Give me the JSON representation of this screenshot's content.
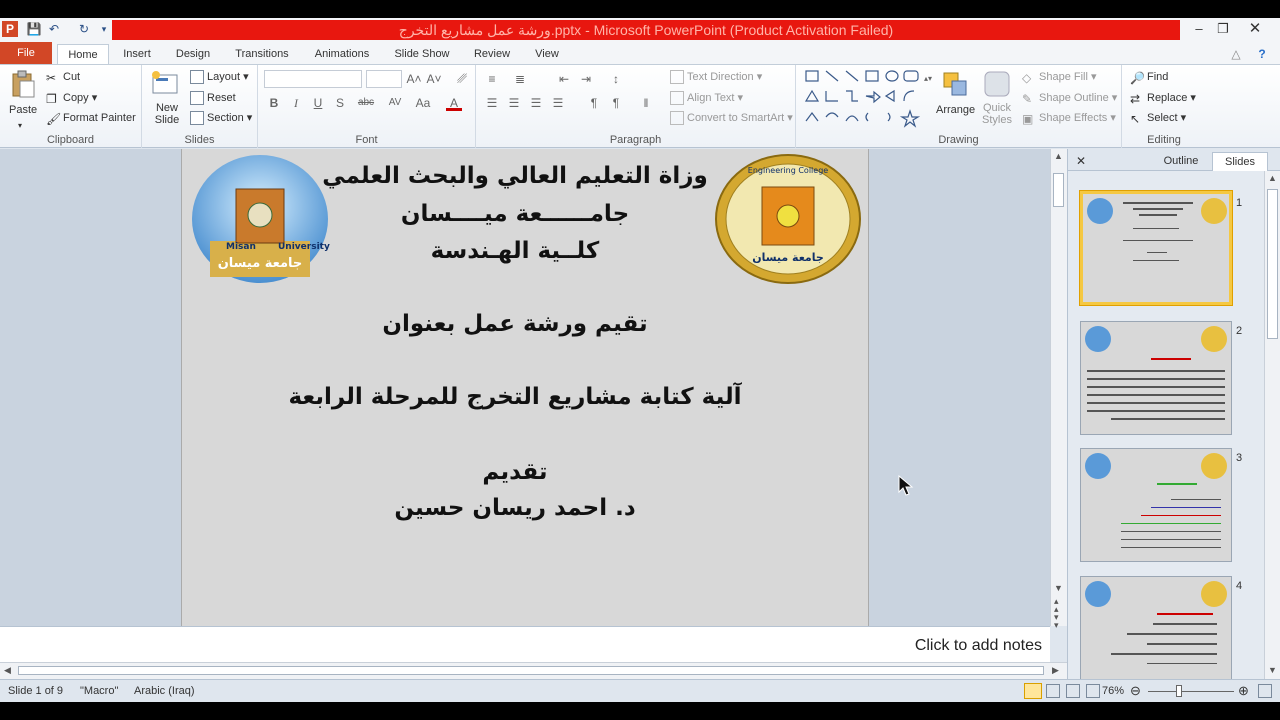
{
  "window": {
    "title": "ورشة عمل مشاريع التخرج.pptx - Microsoft PowerPoint (Product Activation Failed)"
  },
  "tabs": [
    "File",
    "Home",
    "Insert",
    "Design",
    "Transitions",
    "Animations",
    "Slide Show",
    "Review",
    "View"
  ],
  "ribbon": {
    "clipboard": {
      "label": "Clipboard",
      "paste": "Paste",
      "cut": "Cut",
      "copy": "Copy",
      "format_painter": "Format Painter"
    },
    "slides": {
      "label": "Slides",
      "new_slide": "New Slide",
      "layout": "Layout",
      "reset": "Reset",
      "section": "Section"
    },
    "font": {
      "label": "Font",
      "bold": "B",
      "italic": "I",
      "underline": "U",
      "shadow": "S",
      "strike": "abc",
      "spacing": "AV",
      "case": "Aa",
      "color": "A"
    },
    "paragraph": {
      "label": "Paragraph",
      "text_direction": "Text Direction",
      "align_text": "Align Text",
      "convert_smartart": "Convert to SmartArt"
    },
    "drawing": {
      "label": "Drawing",
      "arrange": "Arrange",
      "quick_styles": "Quick Styles",
      "shape_fill": "Shape Fill",
      "shape_outline": "Shape Outline",
      "shape_effects": "Shape Effects"
    },
    "editing": {
      "label": "Editing",
      "find": "Find",
      "replace": "Replace",
      "select": "Select"
    }
  },
  "slide": {
    "line1": "وزاة التعليم العالي والبحث العلمي",
    "line2": "جامــــــعة ميــــسان",
    "line3": "كلــية الهـندسة",
    "line4": "تقيم ورشة عمل بعنوان",
    "line5": "آلية كتابة مشاريع التخرج للمرحلة الرابعة",
    "line6": "تقديم",
    "line7": "د. احمد ريسان حسين",
    "logo_left_text": "Misan University",
    "logo_left_arabic": "جامعة ميسان",
    "logo_right_text": "Engineering College",
    "logo_right_arabic": "جامعة ميسان"
  },
  "notes": {
    "placeholder": "Click to add notes"
  },
  "panel": {
    "outline_tab": "Outline",
    "slides_tab": "Slides",
    "thumbs": [
      {
        "num": "1"
      },
      {
        "num": "2"
      },
      {
        "num": "3"
      },
      {
        "num": "4"
      }
    ]
  },
  "status": {
    "slide_info": "Slide 1 of 9",
    "theme": "\"Macro\"",
    "language": "Arabic (Iraq)",
    "zoom": "76%"
  },
  "colors": {
    "title_bar_red": "#e8170f",
    "file_tab": "#d24726",
    "selection": "#f5c842"
  }
}
